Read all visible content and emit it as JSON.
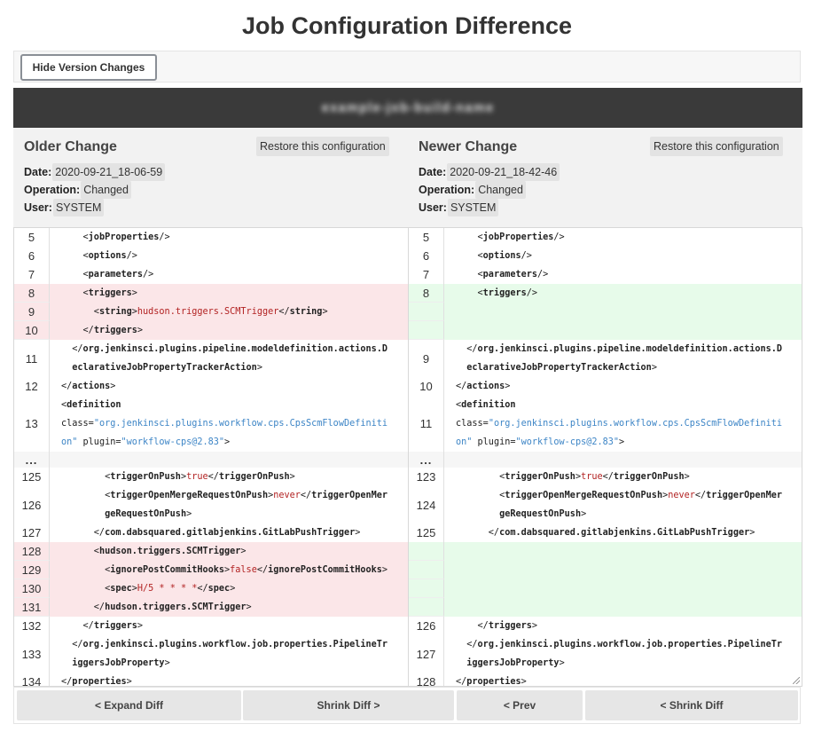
{
  "page": {
    "title": "Job Configuration Difference",
    "hide_changes_label": "Hide Version Changes",
    "job_name": "example-job-build-name"
  },
  "older": {
    "title": "Older Change",
    "restore_label": "Restore this configuration",
    "date_label": "Date:",
    "date": "2020-09-21_18-06-59",
    "operation_label": "Operation:",
    "operation": "Changed",
    "user_label": "User:",
    "user": "SYSTEM"
  },
  "newer": {
    "title": "Newer Change",
    "restore_label": "Restore this configuration",
    "date_label": "Date:",
    "date": "2020-09-21_18-42-46",
    "operation_label": "Operation:",
    "operation": "Changed",
    "user_label": "User:",
    "user": "SYSTEM"
  },
  "diff": {
    "skip_marker": "...",
    "left": [
      {
        "type": "ctx",
        "num": "5",
        "lines": [
          [
            [
              "    <",
              ""
            ],
            [
              "jobProperties",
              "t"
            ],
            [
              "/>",
              ""
            ]
          ]
        ]
      },
      {
        "type": "ctx",
        "num": "6",
        "lines": [
          [
            [
              "    <",
              ""
            ],
            [
              "options",
              "t"
            ],
            [
              "/>",
              ""
            ]
          ]
        ]
      },
      {
        "type": "ctx",
        "num": "7",
        "lines": [
          [
            [
              "    <",
              ""
            ],
            [
              "parameters",
              "t"
            ],
            [
              "/>",
              ""
            ]
          ]
        ]
      },
      {
        "type": "del",
        "num": "8",
        "lines": [
          [
            [
              "    <",
              ""
            ],
            [
              "triggers",
              "t"
            ],
            [
              ">",
              ""
            ]
          ]
        ]
      },
      {
        "type": "del",
        "num": "9",
        "lines": [
          [
            [
              "      <",
              ""
            ],
            [
              "string",
              "t"
            ],
            [
              ">",
              ""
            ],
            [
              "hudson.triggers.SCMTrigger",
              "s"
            ],
            [
              "</",
              ""
            ],
            [
              "string",
              "t"
            ],
            [
              ">",
              ""
            ]
          ]
        ]
      },
      {
        "type": "del",
        "num": "10",
        "lines": [
          [
            [
              "    </",
              ""
            ],
            [
              "triggers",
              "t"
            ],
            [
              ">",
              ""
            ]
          ]
        ]
      },
      {
        "type": "ctx",
        "num": "11",
        "lines": [
          [
            [
              "  </",
              ""
            ],
            [
              "org.jenkinsci.plugins.pipeline.modeldefinition.actions.D",
              "t"
            ]
          ],
          [
            [
              "  ",
              ""
            ],
            [
              "eclarativeJobPropertyTrackerAction",
              "t"
            ],
            [
              ">",
              ""
            ]
          ]
        ]
      },
      {
        "type": "ctx",
        "num": "12",
        "lines": [
          [
            [
              "</",
              ""
            ],
            [
              "actions",
              "t"
            ],
            [
              ">",
              ""
            ]
          ]
        ]
      },
      {
        "type": "ctx",
        "num": "13",
        "lines": [
          [
            [
              "<",
              ""
            ],
            [
              "definition",
              "t"
            ]
          ],
          [
            [
              "class=",
              ""
            ],
            [
              "\"org.jenkinsci.plugins.workflow.cps.CpsScmFlowDefiniti",
              "a"
            ]
          ],
          [
            [
              "on\"",
              "a"
            ],
            [
              " plugin=",
              ""
            ],
            [
              "\"workflow-cps@2.83\"",
              "a"
            ],
            [
              ">",
              ""
            ]
          ]
        ]
      },
      {
        "type": "skip"
      },
      {
        "type": "ctx",
        "num": "125",
        "lines": [
          [
            [
              "        <",
              ""
            ],
            [
              "triggerOnPush",
              "t"
            ],
            [
              ">",
              ""
            ],
            [
              "true",
              "s"
            ],
            [
              "</",
              ""
            ],
            [
              "triggerOnPush",
              "t"
            ],
            [
              ">",
              ""
            ]
          ]
        ]
      },
      {
        "type": "ctx",
        "num": "126",
        "lines": [
          [
            [
              "        <",
              ""
            ],
            [
              "triggerOpenMergeRequestOnPush",
              "t"
            ],
            [
              ">",
              ""
            ],
            [
              "never",
              "s"
            ],
            [
              "</",
              ""
            ],
            [
              "triggerOpenMer",
              "t"
            ]
          ],
          [
            [
              "        ",
              ""
            ],
            [
              "geRequestOnPush",
              "t"
            ],
            [
              ">",
              ""
            ]
          ]
        ]
      },
      {
        "type": "ctx",
        "num": "127",
        "lines": [
          [
            [
              "      </",
              ""
            ],
            [
              "com.dabsquared.gitlabjenkins.GitLabPushTrigger",
              "t"
            ],
            [
              ">",
              ""
            ]
          ]
        ]
      },
      {
        "type": "del",
        "num": "128",
        "lines": [
          [
            [
              "      <",
              ""
            ],
            [
              "hudson.triggers.SCMTrigger",
              "t"
            ],
            [
              ">",
              ""
            ]
          ]
        ]
      },
      {
        "type": "del",
        "num": "129",
        "lines": [
          [
            [
              "        <",
              ""
            ],
            [
              "ignorePostCommitHooks",
              "t"
            ],
            [
              ">",
              ""
            ],
            [
              "false",
              "s"
            ],
            [
              "</",
              ""
            ],
            [
              "ignorePostCommitHooks",
              "t"
            ],
            [
              ">",
              ""
            ]
          ]
        ]
      },
      {
        "type": "del",
        "num": "130",
        "lines": [
          [
            [
              "        <",
              ""
            ],
            [
              "spec",
              "t"
            ],
            [
              ">",
              ""
            ],
            [
              "H/5 * * * *",
              "s"
            ],
            [
              "</",
              ""
            ],
            [
              "spec",
              "t"
            ],
            [
              ">",
              ""
            ]
          ]
        ]
      },
      {
        "type": "del",
        "num": "131",
        "lines": [
          [
            [
              "      </",
              ""
            ],
            [
              "hudson.triggers.SCMTrigger",
              "t"
            ],
            [
              ">",
              ""
            ]
          ]
        ]
      },
      {
        "type": "ctx",
        "num": "132",
        "lines": [
          [
            [
              "    </",
              ""
            ],
            [
              "triggers",
              "t"
            ],
            [
              ">",
              ""
            ]
          ]
        ]
      },
      {
        "type": "ctx",
        "num": "133",
        "lines": [
          [
            [
              "  </",
              ""
            ],
            [
              "org.jenkinsci.plugins.workflow.job.properties.PipelineTr",
              "t"
            ]
          ],
          [
            [
              "  ",
              ""
            ],
            [
              "iggersJobProperty",
              "t"
            ],
            [
              ">",
              ""
            ]
          ]
        ]
      },
      {
        "type": "ctx",
        "num": "134",
        "lines": [
          [
            [
              "</",
              ""
            ],
            [
              "properties",
              "t"
            ],
            [
              ">",
              ""
            ]
          ]
        ]
      }
    ],
    "right": [
      {
        "type": "ctx",
        "num": "5",
        "lines": [
          [
            [
              "    <",
              ""
            ],
            [
              "jobProperties",
              "t"
            ],
            [
              "/>",
              ""
            ]
          ]
        ]
      },
      {
        "type": "ctx",
        "num": "6",
        "lines": [
          [
            [
              "    <",
              ""
            ],
            [
              "options",
              "t"
            ],
            [
              "/>",
              ""
            ]
          ]
        ]
      },
      {
        "type": "ctx",
        "num": "7",
        "lines": [
          [
            [
              "    <",
              ""
            ],
            [
              "parameters",
              "t"
            ],
            [
              "/>",
              ""
            ]
          ]
        ]
      },
      {
        "type": "add",
        "num": "8",
        "lines": [
          [
            [
              "    <",
              ""
            ],
            [
              "triggers",
              "t"
            ],
            [
              "/>",
              ""
            ]
          ]
        ]
      },
      {
        "type": "add",
        "num": "",
        "lines": [
          []
        ]
      },
      {
        "type": "add",
        "num": "",
        "lines": [
          []
        ]
      },
      {
        "type": "ctx",
        "num": "9",
        "lines": [
          [
            [
              "  </",
              ""
            ],
            [
              "org.jenkinsci.plugins.pipeline.modeldefinition.actions.D",
              "t"
            ]
          ],
          [
            [
              "  ",
              ""
            ],
            [
              "eclarativeJobPropertyTrackerAction",
              "t"
            ],
            [
              ">",
              ""
            ]
          ]
        ]
      },
      {
        "type": "ctx",
        "num": "10",
        "lines": [
          [
            [
              "</",
              ""
            ],
            [
              "actions",
              "t"
            ],
            [
              ">",
              ""
            ]
          ]
        ]
      },
      {
        "type": "ctx",
        "num": "11",
        "lines": [
          [
            [
              "<",
              ""
            ],
            [
              "definition",
              "t"
            ]
          ],
          [
            [
              "class=",
              ""
            ],
            [
              "\"org.jenkinsci.plugins.workflow.cps.CpsScmFlowDefiniti",
              "a"
            ]
          ],
          [
            [
              "on\"",
              "a"
            ],
            [
              " plugin=",
              ""
            ],
            [
              "\"workflow-cps@2.83\"",
              "a"
            ],
            [
              ">",
              ""
            ]
          ]
        ]
      },
      {
        "type": "skip"
      },
      {
        "type": "ctx",
        "num": "123",
        "lines": [
          [
            [
              "        <",
              ""
            ],
            [
              "triggerOnPush",
              "t"
            ],
            [
              ">",
              ""
            ],
            [
              "true",
              "s"
            ],
            [
              "</",
              ""
            ],
            [
              "triggerOnPush",
              "t"
            ],
            [
              ">",
              ""
            ]
          ]
        ]
      },
      {
        "type": "ctx",
        "num": "124",
        "lines": [
          [
            [
              "        <",
              ""
            ],
            [
              "triggerOpenMergeRequestOnPush",
              "t"
            ],
            [
              ">",
              ""
            ],
            [
              "never",
              "s"
            ],
            [
              "</",
              ""
            ],
            [
              "triggerOpenMer",
              "t"
            ]
          ],
          [
            [
              "        ",
              ""
            ],
            [
              "geRequestOnPush",
              "t"
            ],
            [
              ">",
              ""
            ]
          ]
        ]
      },
      {
        "type": "ctx",
        "num": "125",
        "lines": [
          [
            [
              "      </",
              ""
            ],
            [
              "com.dabsquared.gitlabjenkins.GitLabPushTrigger",
              "t"
            ],
            [
              ">",
              ""
            ]
          ]
        ]
      },
      {
        "type": "add",
        "num": "",
        "lines": [
          []
        ]
      },
      {
        "type": "add",
        "num": "",
        "lines": [
          []
        ]
      },
      {
        "type": "add",
        "num": "",
        "lines": [
          []
        ]
      },
      {
        "type": "add",
        "num": "",
        "lines": [
          []
        ]
      },
      {
        "type": "ctx",
        "num": "126",
        "lines": [
          [
            [
              "    </",
              ""
            ],
            [
              "triggers",
              "t"
            ],
            [
              ">",
              ""
            ]
          ]
        ]
      },
      {
        "type": "ctx",
        "num": "127",
        "lines": [
          [
            [
              "  </",
              ""
            ],
            [
              "org.jenkinsci.plugins.workflow.job.properties.PipelineTr",
              "t"
            ]
          ],
          [
            [
              "  ",
              ""
            ],
            [
              "iggersJobProperty",
              "t"
            ],
            [
              ">",
              ""
            ]
          ]
        ]
      },
      {
        "type": "ctx",
        "num": "128",
        "lines": [
          [
            [
              "</",
              ""
            ],
            [
              "properties",
              "t"
            ],
            [
              ">",
              ""
            ]
          ]
        ]
      }
    ]
  },
  "nav": {
    "expand_label": "< Expand Diff",
    "shrink_label": "Shrink Diff >",
    "prev_label": "< Prev",
    "shrink_back_label": "< Shrink Diff"
  }
}
